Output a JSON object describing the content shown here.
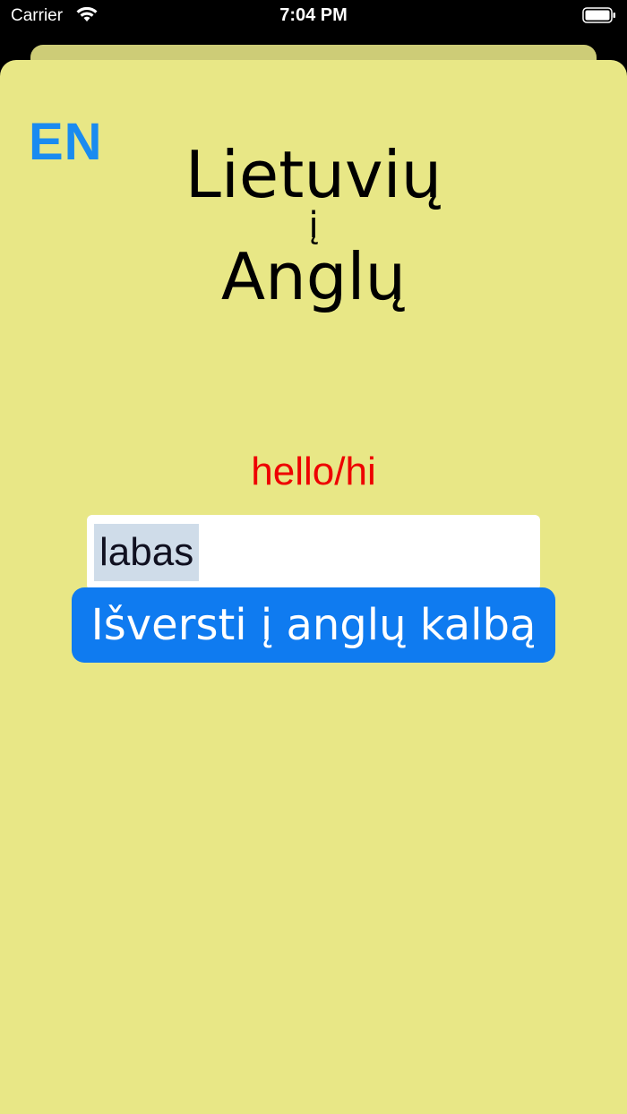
{
  "status_bar": {
    "carrier": "Carrier",
    "time": "7:04 PM"
  },
  "header": {
    "language_toggle": "EN",
    "title_from": "Lietuvių",
    "title_connector": "į",
    "title_to": "Anglų"
  },
  "main": {
    "translation_result": "hello/hi",
    "input_value": "labas",
    "translate_button_label": "Išversti į anglų kalbą"
  },
  "colors": {
    "sheet_background": "#e8e786",
    "accent_blue": "#0f7bf0",
    "result_red": "#ee0000"
  }
}
